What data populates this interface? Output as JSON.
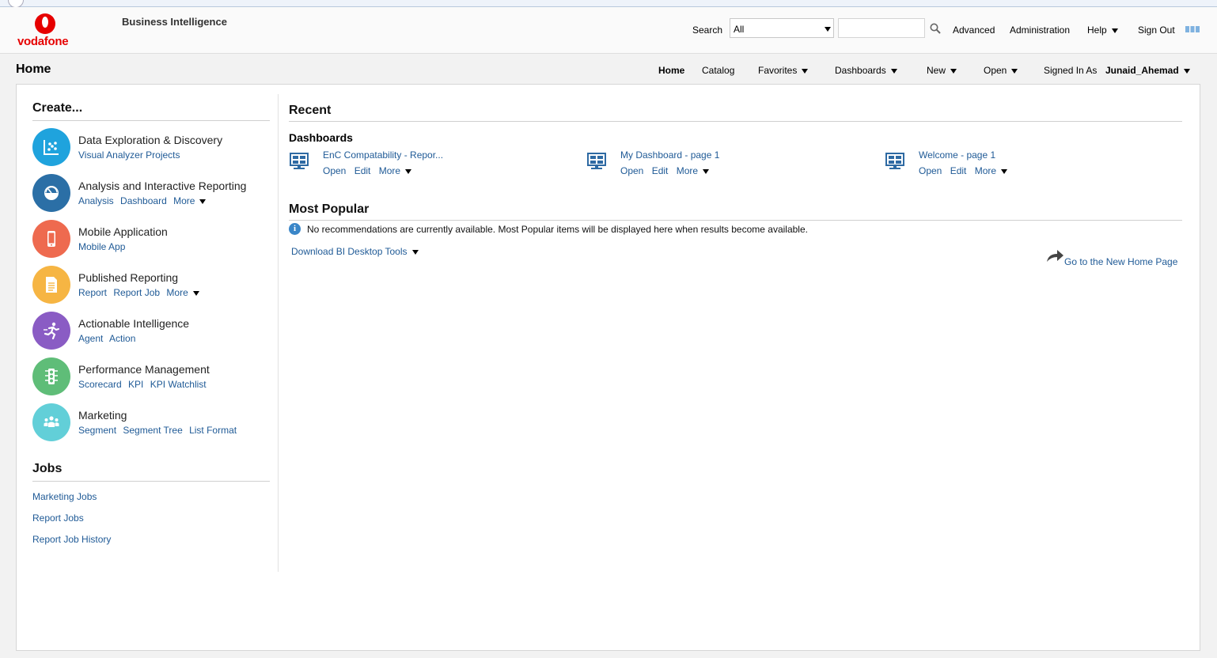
{
  "header": {
    "logo_text": "vodafone",
    "app_title": "Business Intelligence",
    "search_label": "Search",
    "search_scope": "All",
    "search_value": "",
    "links": {
      "advanced": "Advanced",
      "administration": "Administration",
      "help": "Help",
      "sign_out": "Sign Out"
    }
  },
  "titlebar": {
    "page_title": "Home",
    "nav": {
      "home": "Home",
      "catalog": "Catalog",
      "favorites": "Favorites",
      "dashboards": "Dashboards",
      "new": "New",
      "open": "Open"
    },
    "signed_in_label": "Signed In As",
    "username": "Junaid_Ahemad"
  },
  "create": {
    "title": "Create...",
    "items": [
      {
        "name": "Data Exploration & Discovery",
        "color": "#1fa3dd",
        "icon": "scatter-chart-icon",
        "links": [
          "Visual Analyzer Projects"
        ],
        "more": ""
      },
      {
        "name": "Analysis and Interactive Reporting",
        "color": "#2b6fa6",
        "icon": "gauge-icon",
        "links": [
          "Analysis",
          "Dashboard"
        ],
        "more": "More"
      },
      {
        "name": "Mobile Application",
        "color": "#ee6a4f",
        "icon": "mobile-phone-icon",
        "links": [
          "Mobile App"
        ],
        "more": ""
      },
      {
        "name": "Published Reporting",
        "color": "#f6b543",
        "icon": "document-icon",
        "links": [
          "Report",
          "Report Job"
        ],
        "more": "More"
      },
      {
        "name": "Actionable Intelligence",
        "color": "#8a5cc4",
        "icon": "running-person-icon",
        "links": [
          "Agent",
          "Action"
        ],
        "more": ""
      },
      {
        "name": "Performance Management",
        "color": "#5fbd78",
        "icon": "traffic-light-icon",
        "links": [
          "Scorecard",
          "KPI",
          "KPI Watchlist"
        ],
        "more": ""
      },
      {
        "name": "Marketing",
        "color": "#62cfd8",
        "icon": "people-group-icon",
        "links": [
          "Segment",
          "Segment Tree",
          "List Format"
        ],
        "more": ""
      }
    ]
  },
  "jobs": {
    "title": "Jobs",
    "links": [
      "Marketing Jobs",
      "Report Jobs",
      "Report Job History"
    ]
  },
  "recent": {
    "title": "Recent",
    "dashboards_title": "Dashboards",
    "items": [
      {
        "title": "EnC Compatability - Repor...",
        "actions": [
          "Open",
          "Edit",
          "More"
        ]
      },
      {
        "title": "My Dashboard - page 1",
        "actions": [
          "Open",
          "Edit",
          "More"
        ]
      },
      {
        "title": "Welcome - page 1",
        "actions": [
          "Open",
          "Edit",
          "More"
        ]
      }
    ]
  },
  "popular": {
    "title": "Most Popular",
    "message": "No recommendations are currently available. Most Popular items will be displayed here when results become available.",
    "download_label": "Download BI Desktop Tools",
    "new_home_label": "Go to the New Home Page"
  }
}
